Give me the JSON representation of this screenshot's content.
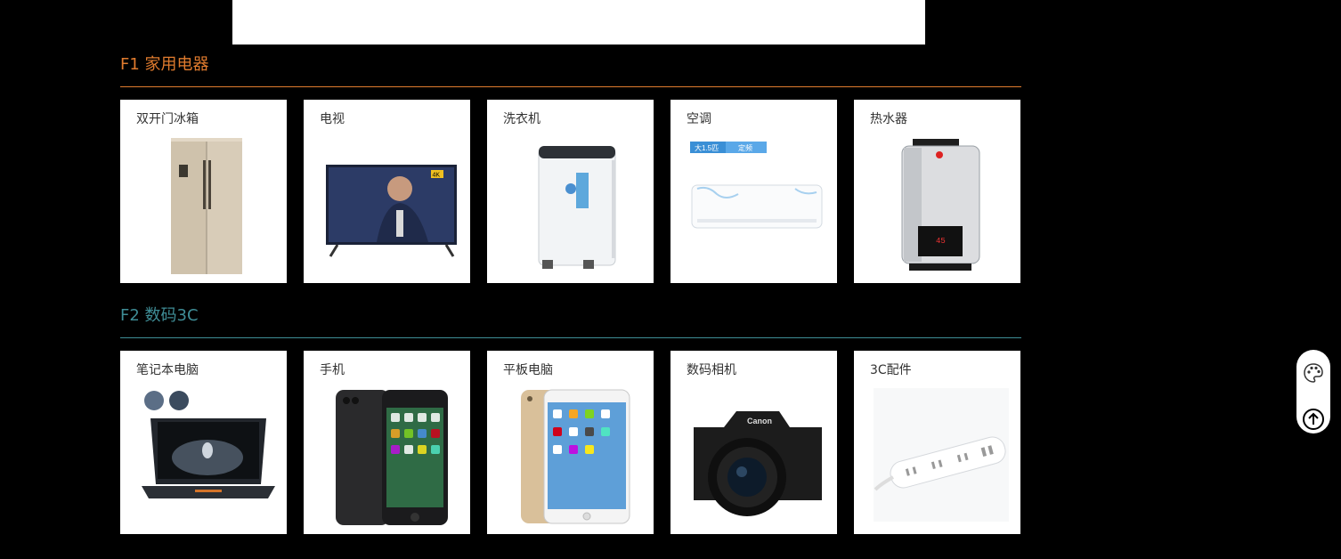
{
  "floors": [
    {
      "title": "F1 家用电器",
      "color": "#e07b2e",
      "items": [
        {
          "label": "双开门冰箱",
          "icon": "refrigerator-image"
        },
        {
          "label": "电视",
          "icon": "tv-image"
        },
        {
          "label": "洗衣机",
          "icon": "washing-machine-image"
        },
        {
          "label": "空调",
          "icon": "air-conditioner-image",
          "tags": [
            "大1.5匹",
            "定频"
          ]
        },
        {
          "label": "热水器",
          "icon": "water-heater-image"
        }
      ]
    },
    {
      "title": "F2 数码3C",
      "color": "#3f8d96",
      "items": [
        {
          "label": "笔记本电脑",
          "icon": "laptop-image"
        },
        {
          "label": "手机",
          "icon": "phone-image"
        },
        {
          "label": "平板电脑",
          "icon": "tablet-image"
        },
        {
          "label": "数码相机",
          "icon": "camera-image",
          "brand": "Canon"
        },
        {
          "label": "3C配件",
          "icon": "power-strip-image"
        }
      ]
    }
  ],
  "tv_badge": "4K",
  "side_tools": {
    "theme_icon": "palette-icon",
    "top_icon": "back-to-top-icon"
  }
}
